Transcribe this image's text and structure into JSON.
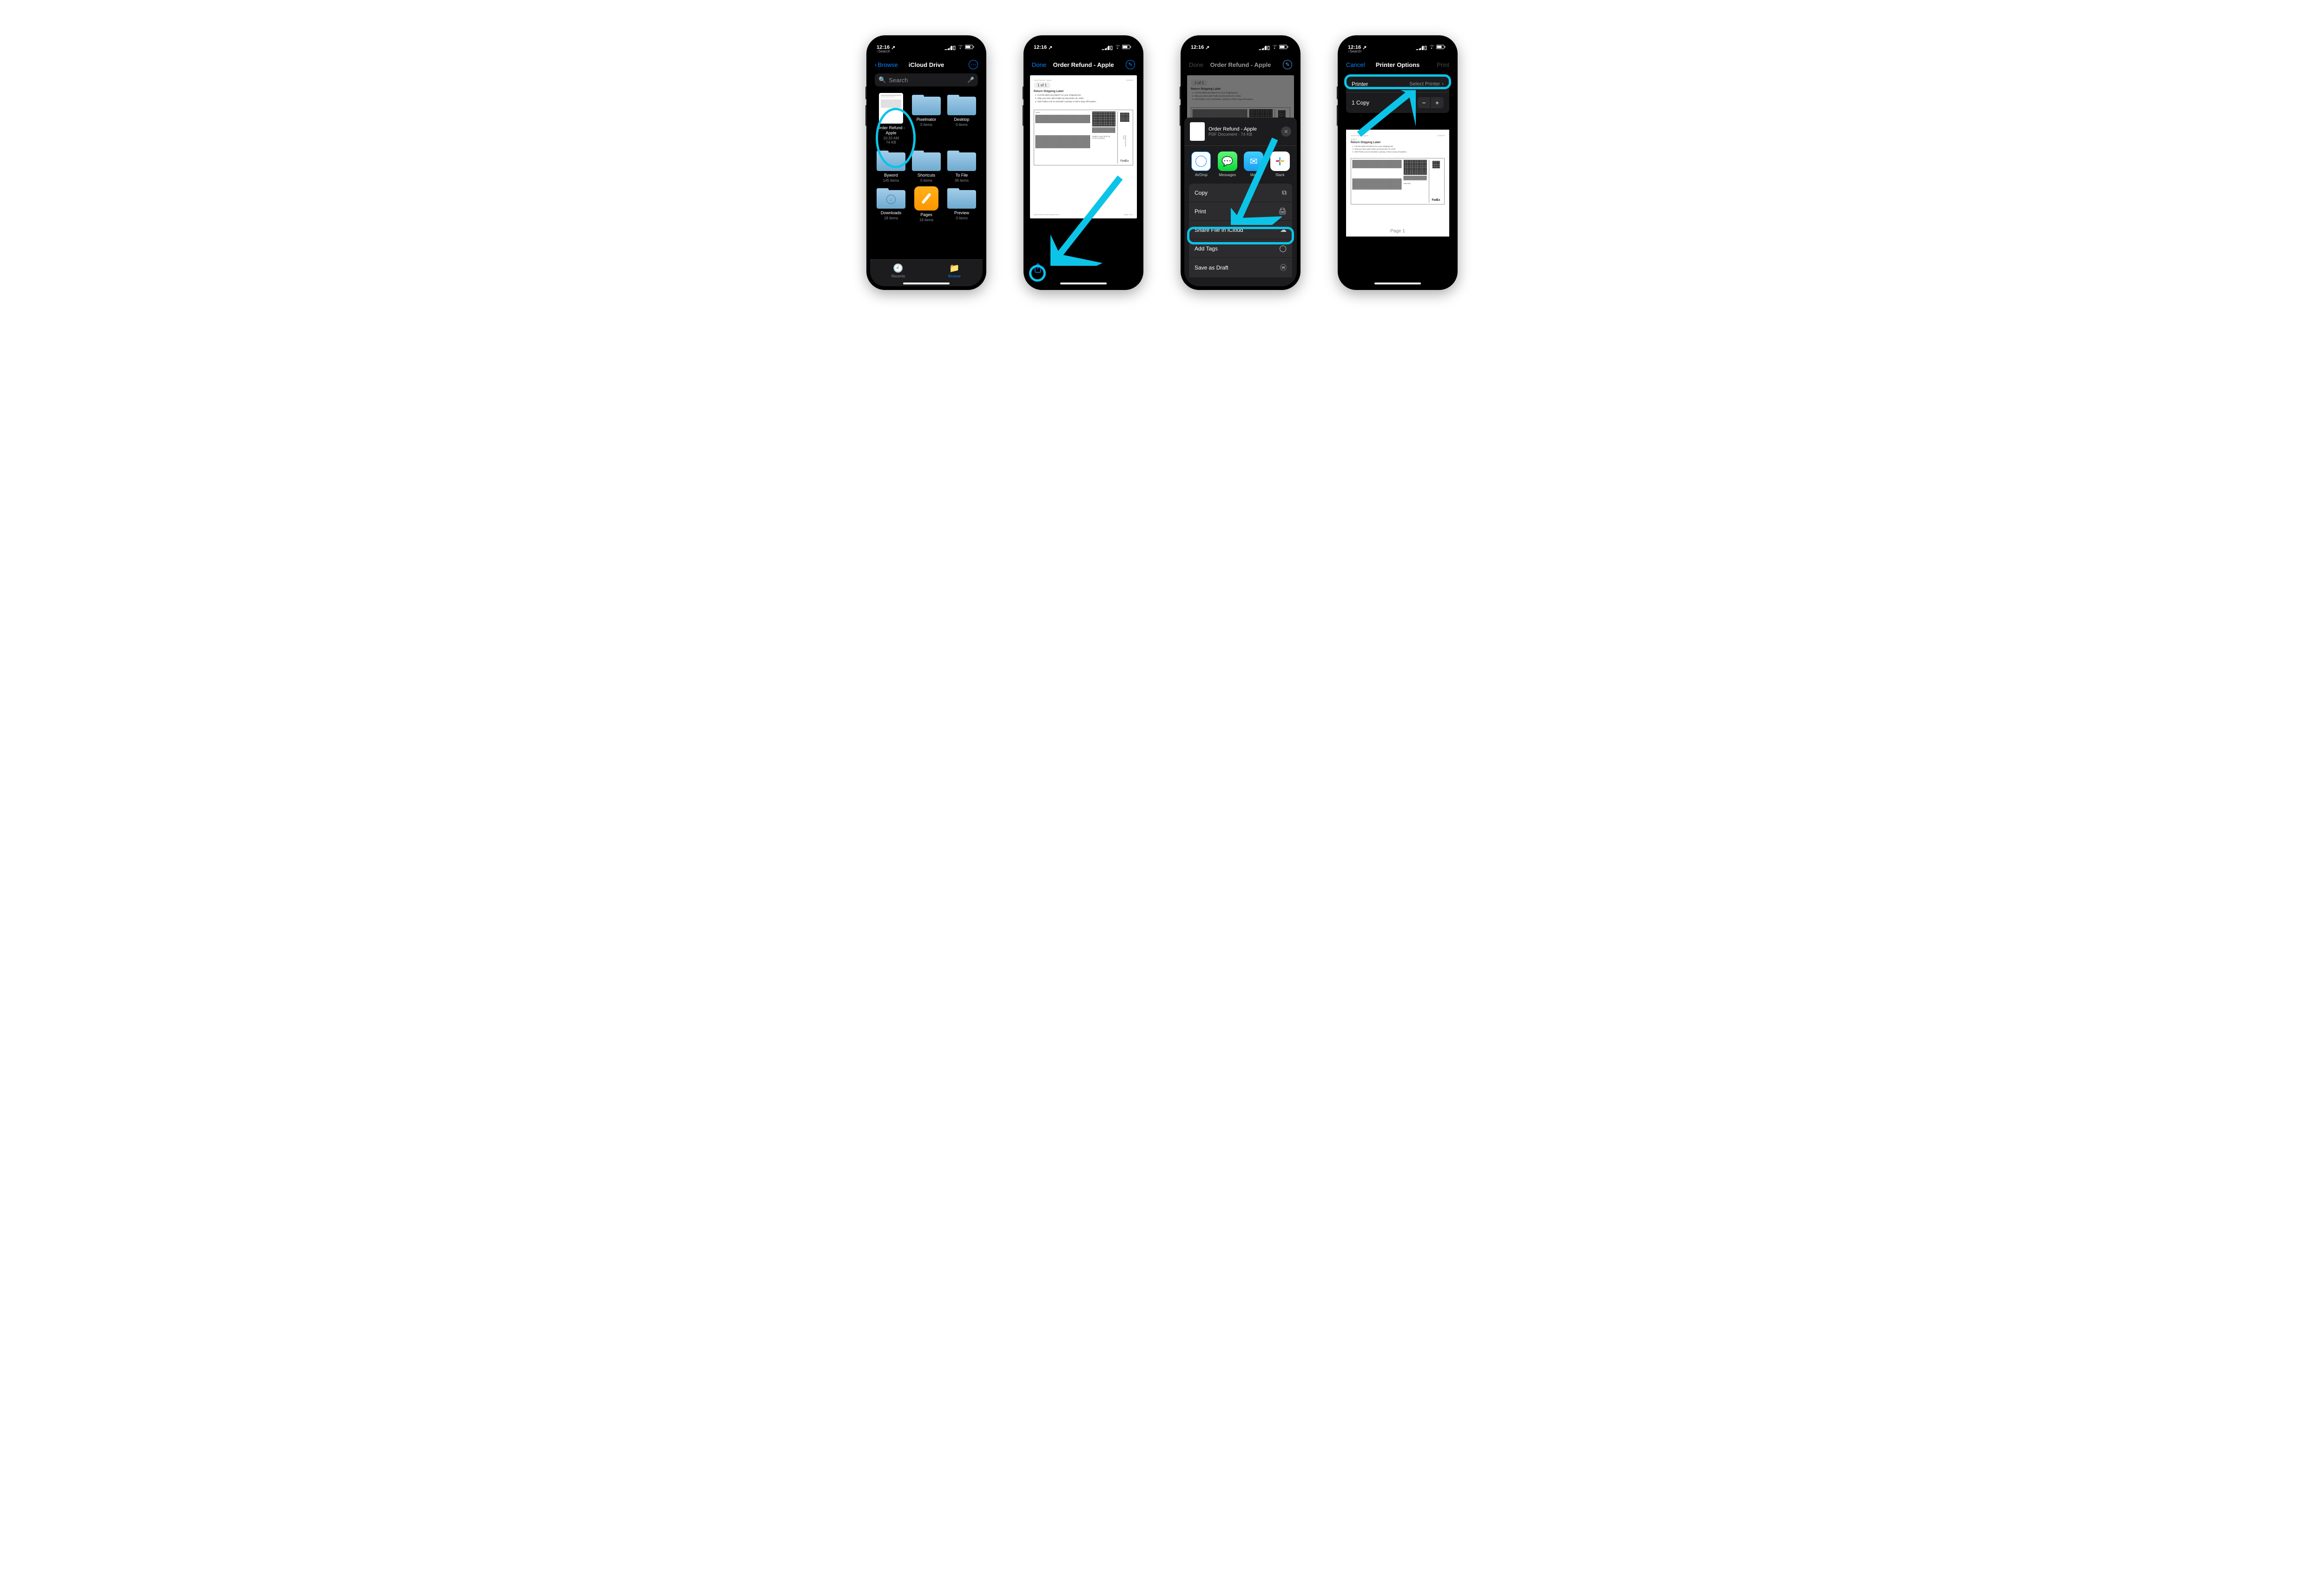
{
  "status": {
    "time": "12:16",
    "location_arrow": "↗",
    "back_hint": "Search"
  },
  "screen1": {
    "nav": {
      "back": "Browse",
      "title": "iCloud Drive",
      "action": "⋯"
    },
    "search": {
      "placeholder": "Search"
    },
    "items": [
      {
        "name": "Order Refund - Apple",
        "meta1": "10:33 AM",
        "meta2": "74 KB",
        "kind": "doc"
      },
      {
        "name": "Pixelmator",
        "meta1": "0 items",
        "kind": "folder"
      },
      {
        "name": "Desktop",
        "meta1": "0 items",
        "kind": "folder"
      },
      {
        "name": "Byword",
        "meta1": "145 items",
        "kind": "folder"
      },
      {
        "name": "Shortcuts",
        "meta1": "0 items",
        "kind": "folder"
      },
      {
        "name": "To File",
        "meta1": "36 items",
        "kind": "folder"
      },
      {
        "name": "Downloads",
        "meta1": "18 items",
        "kind": "folder-dl"
      },
      {
        "name": "Pages",
        "meta1": "19 items",
        "kind": "pages"
      },
      {
        "name": "Preview",
        "meta1": "3 items",
        "kind": "folder"
      }
    ],
    "tabs": {
      "recents": "Recents",
      "browse": "Browse"
    }
  },
  "screen2": {
    "nav": {
      "done": "Done",
      "title": "Order Refund - Apple"
    },
    "doc": {
      "pages": "1 of 1",
      "heading": "Return Shipping Label",
      "steps": [
        "Cut this label and attach it to your shipping box.",
        "Ship your item with FedEx by December 03, 2020.",
        "Visit FedEx.com to schedule a pickup or find a drop-off location."
      ],
      "footer_left": "https://secure.store.apple.com/...",
      "footer_right": "Page 1 of 1"
    }
  },
  "screen3": {
    "nav": {
      "done": "Done",
      "title": "Order Refund - Apple"
    },
    "sheet": {
      "title": "Order Refund - Apple",
      "subtitle": "PDF Document · 74 KB",
      "apps": [
        {
          "label": "AirDrop",
          "cls": "ai-airdrop"
        },
        {
          "label": "Messages",
          "cls": "ai-msg",
          "glyph": "💬"
        },
        {
          "label": "Mail",
          "cls": "ai-mail",
          "glyph": "✉"
        },
        {
          "label": "Slack",
          "cls": "ai-slack",
          "glyph": "⬚"
        }
      ],
      "actions": [
        {
          "label": "Copy",
          "icon": "⧉"
        },
        {
          "label": "Print",
          "icon": "🖨"
        },
        {
          "label": "Share File in iCloud",
          "icon": "☁"
        },
        {
          "label": "Add Tags",
          "icon": "◯"
        },
        {
          "label": "Save as Draft",
          "icon": "ⓦ"
        }
      ]
    }
  },
  "screen4": {
    "nav": {
      "cancel": "Cancel",
      "title": "Printer Options",
      "print": "Print"
    },
    "rows": {
      "printer_label": "Printer",
      "printer_value": "Select Printer",
      "copies": "1 Copy"
    },
    "preview": {
      "page_label": "Page 1"
    }
  }
}
